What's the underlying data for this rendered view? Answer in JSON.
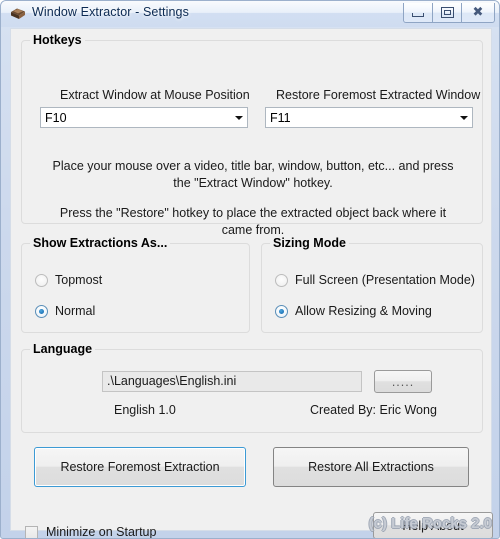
{
  "window": {
    "title": "Window Extractor - Settings",
    "icon": "window-extractor-icon",
    "controls": {
      "minimize": "Minimize",
      "maximize": "Maximize",
      "close": "Close"
    }
  },
  "hotkeys": {
    "group_label": "Hotkeys",
    "extract": {
      "label": "Extract Window at Mouse Position",
      "value": "F10"
    },
    "restore": {
      "label": "Restore Foremost Extracted Window",
      "value": "F11"
    },
    "help_line_1": "Place your mouse over a video, title bar, window, button, etc... and press the \"Extract Window\" hotkey.",
    "help_line_2": "Press the \"Restore\" hotkey to place the extracted object back where it came from."
  },
  "show_extractions": {
    "group_label": "Show Extractions As...",
    "options": [
      {
        "label": "Topmost",
        "selected": false
      },
      {
        "label": "Normal",
        "selected": true
      }
    ]
  },
  "sizing_mode": {
    "group_label": "Sizing Mode",
    "options": [
      {
        "label": "Full Screen (Presentation Mode)",
        "selected": false
      },
      {
        "label": "Allow Resizing & Moving",
        "selected": true
      }
    ]
  },
  "language": {
    "group_label": "Language",
    "path": ".\\Languages\\English.ini",
    "browse_label": ".....",
    "version": "English 1.0",
    "author": "Created By: Eric Wong"
  },
  "actions": {
    "restore_foremost": "Restore Foremost Extraction",
    "restore_all": "Restore All Extractions",
    "help_about": "Help  About"
  },
  "startup": {
    "minimize_label": "Minimize on Startup",
    "minimize_checked": false
  },
  "watermark": "(c) Life Rocks 2.0",
  "colors": {
    "frame": "#cdd9ed",
    "client": "#f0f0f0",
    "focus_border": "#3c9ad4",
    "radio_dot": "#1d74b8",
    "title_text": "#0c2a52"
  }
}
